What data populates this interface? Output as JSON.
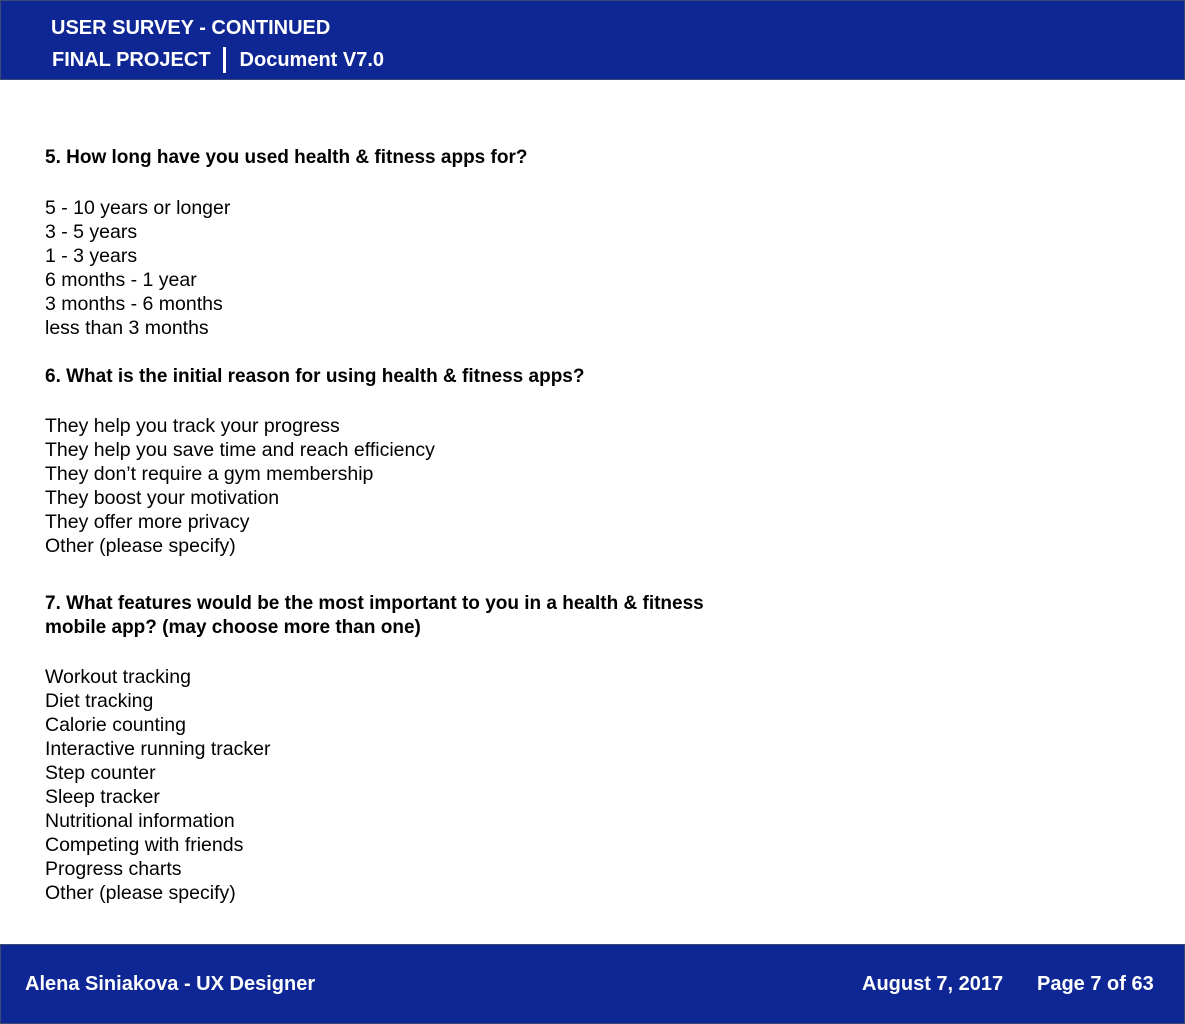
{
  "header": {
    "title": "USER SURVEY - CONTINUED",
    "project": "FINAL PROJECT",
    "document_version": "Document V7.0"
  },
  "questions": [
    {
      "text": "5. How long have you used health & fitness apps for?",
      "options": [
        "5 - 10 years or longer",
        "3 - 5 years",
        "1 - 3 years",
        "6 months - 1 year",
        "3 months - 6 months",
        "less than 3 months"
      ]
    },
    {
      "text": "6. What is the initial reason for using health & fitness apps?",
      "options": [
        "They help you track your progress",
        "They help you save time and reach efficiency",
        "They don’t require a gym membership",
        "They boost your motivation",
        "They offer more privacy",
        "Other (please specify)"
      ]
    },
    {
      "text_line1": "7. What features would be the most important to you in a health & fitness",
      "text_line2": "mobile app? (may choose more than one)",
      "options": [
        "Workout tracking",
        "Diet tracking",
        "Calorie counting",
        "Interactive running tracker",
        "Step counter",
        "Sleep tracker",
        "Nutritional information",
        "Competing with friends",
        "Progress charts",
        "Other (please specify)"
      ]
    }
  ],
  "footer": {
    "author": "Alena Siniakova - UX Designer",
    "date": "August 7, 2017",
    "page": "Page 7 of 63"
  },
  "colors": {
    "header_footer_bg": "#0e2795",
    "header_footer_text": "#ffffff",
    "body_text": "#000000"
  }
}
